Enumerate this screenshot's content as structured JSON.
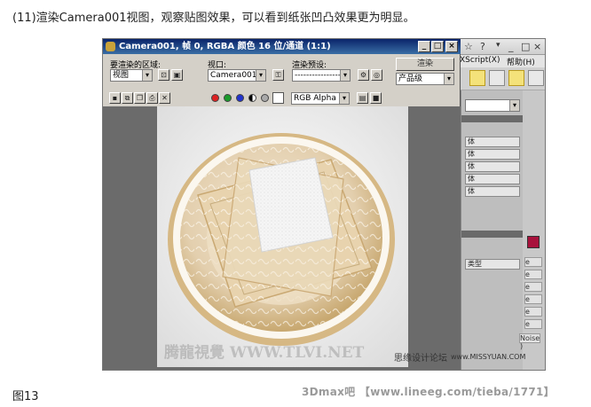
{
  "caption_top": "(11)渲染Camera001视图，观察贴图效果，可以看到纸张凹凸效果更为明显。",
  "caption_bottom": "图13",
  "watermark_bottom": "3Dmax吧 【www.lineeg.com/tieba/1771】",
  "render_window": {
    "title": "Camera001, 帧 0, RGBA 颜色 16 位/通道 (1:1)",
    "controls": {
      "minimize": "_",
      "maximize": "□",
      "close": "×"
    },
    "area_label": "要渲染的区域:",
    "area_value": "视图",
    "viewport_label": "视口:",
    "viewport_value": "Camera001",
    "preset_label": "渲染预设:",
    "preset_value": "--------------------",
    "render_button": "渲染",
    "quality_value": "产品级",
    "channel_value": "RGB Alpha",
    "watermark_render": "腾龍視覺 WWW.TLVI.NET"
  },
  "background_app": {
    "menu_items": [
      "XScript(X)",
      "帮助(H)"
    ],
    "title_icons": [
      "☆",
      "?"
    ],
    "side_panel_items": [
      "体",
      "体",
      "体",
      "体",
      "体",
      "类型"
    ],
    "right_panel_items": [
      "e",
      "e",
      "e",
      "e",
      "e",
      "e",
      "Noise )"
    ]
  },
  "forum_watermark": "思缘设计论坛",
  "forum_url": "www.MISSYUAN.COM",
  "colors": {
    "title_bar": "#0a246a",
    "accent_red": "#a8123c",
    "plate_rim": "#c8a870",
    "highlight_btn": "#f4e27a"
  }
}
